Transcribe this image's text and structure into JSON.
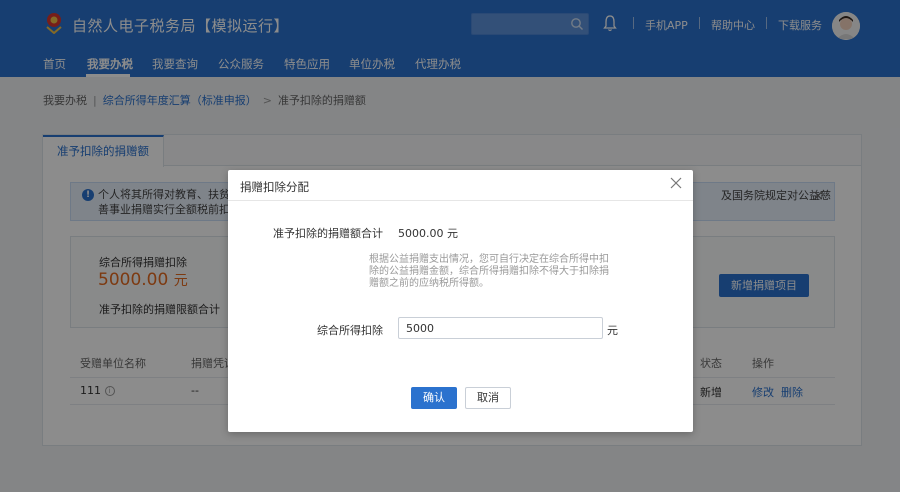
{
  "header": {
    "title": "自然人电子税务局【模拟运行】",
    "links": [
      "手机APP",
      "帮助中心",
      "下载服务"
    ]
  },
  "nav": {
    "items": [
      "首页",
      "我要办税",
      "我要查询",
      "公众服务",
      "特色应用",
      "单位办税",
      "代理办税"
    ],
    "active": "我要办税"
  },
  "breadcrumb": {
    "root": "我要办税",
    "parent": "综合所得年度汇算（标准申报）",
    "current": "准予扣除的捐赠额"
  },
  "tab": {
    "label": "准予扣除的捐赠额"
  },
  "notice": {
    "line1": "个人将其所得对教育、扶贫、",
    "line2": "善事业捐赠实行全额税前扣",
    "right": "及国务院规定对公益慈",
    "close": "×"
  },
  "summary": {
    "label": "综合所得捐赠扣除",
    "value": "5000.00",
    "unit": "元",
    "sub_label": "准予扣除的捐赠限额合计",
    "add_button": "新增捐赠项目"
  },
  "table": {
    "headers": {
      "org": "受赠单位名称",
      "cert": "捐赠凭证",
      "status": "状态",
      "action": "操作"
    },
    "rows": [
      {
        "org": "111",
        "cert": "--",
        "status": "新增",
        "edit": "修改",
        "delete": "删除"
      }
    ]
  },
  "modal": {
    "title": "捐赠扣除分配",
    "total_label": "准予扣除的捐赠额合计",
    "total_value": "5000.00 元",
    "hint": "根据公益捐赠支出情况，您可自行决定在综合所得中扣除的公益捐赠金额，综合所得捐赠扣除不得大于扣除捐赠额之前的应纳税所得额。",
    "input_label": "综合所得扣除",
    "input_value": "5000",
    "input_unit": "元",
    "ok": "确认",
    "cancel": "取消"
  }
}
